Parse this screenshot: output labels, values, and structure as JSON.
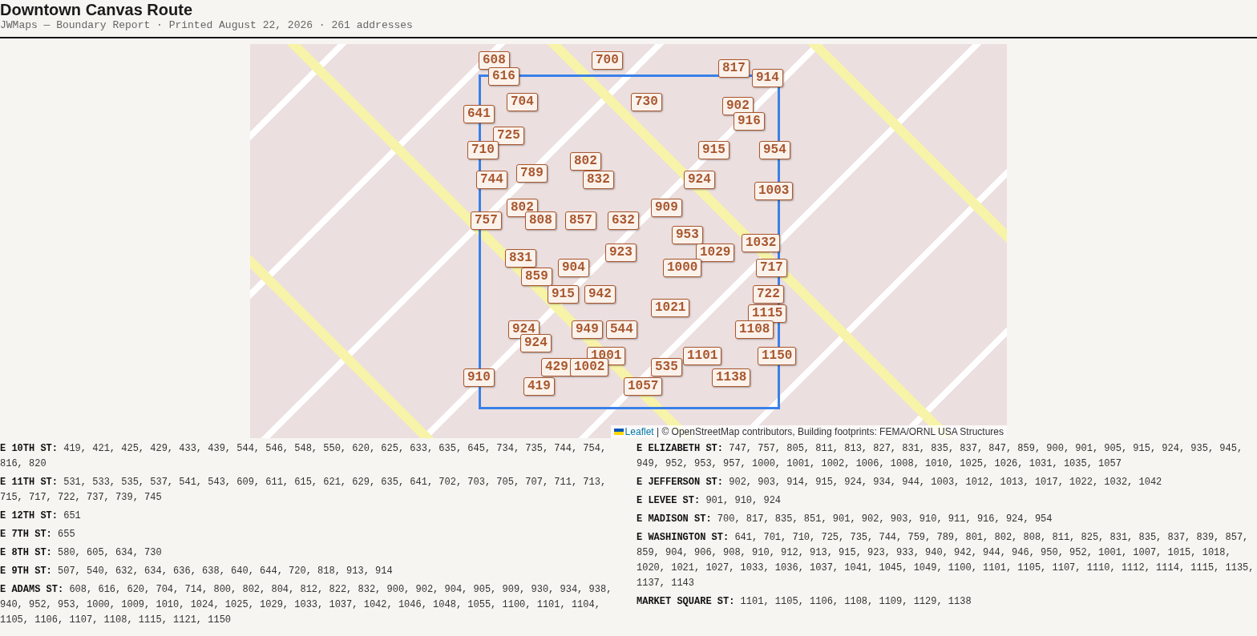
{
  "title": "Downtown Canvas Route",
  "subtitle": "JWMaps — Boundary Report · Printed August 22, 2026 · 261 addresses",
  "map": {
    "markers": [
      "608",
      "700",
      "817",
      "616",
      "914",
      "704",
      "730",
      "902",
      "641",
      "916",
      "725",
      "710",
      "915",
      "954",
      "802",
      "789",
      "744",
      "832",
      "924",
      "1003",
      "802",
      "909",
      "757",
      "808",
      "857",
      "632",
      "953",
      "1032",
      "923",
      "1029",
      "831",
      "904",
      "1000",
      "717",
      "859",
      "915",
      "942",
      "722",
      "1021",
      "1115",
      "924",
      "949",
      "544",
      "1108",
      "924",
      "1001",
      "1101",
      "1150",
      "429",
      "1002",
      "535",
      "910",
      "1138",
      "419",
      "1057"
    ],
    "attribution": {
      "link": "Leaflet",
      "text": "| © OpenStreetMap contributors, Building footprints: FEMA/ORNL USA Structures"
    }
  },
  "columns": [
    {
      "streets": [
        {
          "name": "E 10TH ST:",
          "numbers": "419, 421, 425, 429, 433, 439, 544, 546, 548, 550, 620, 625, 633, 635, 645, 734, 735, 744, 754, 816, 820"
        },
        {
          "name": "E 11TH ST:",
          "numbers": "531, 533, 535, 537, 541, 543, 609, 611, 615, 621, 629, 635, 641, 702, 703, 705, 707, 711, 713, 715, 717, 722, 737, 739, 745"
        },
        {
          "name": "E 12TH ST:",
          "numbers": "651"
        },
        {
          "name": "E 7TH ST:",
          "numbers": "655"
        },
        {
          "name": "E 8TH ST:",
          "numbers": "580, 605, 634, 730"
        },
        {
          "name": "E 9TH ST:",
          "numbers": "507, 540, 632, 634, 636, 638, 640, 644, 720, 818, 913, 914"
        },
        {
          "name": "E ADAMS ST:",
          "numbers": "608, 616, 620, 704, 714, 800, 802, 804, 812, 822, 832, 900, 902, 904, 905, 909, 930, 934, 938, 940, 952, 953, 1000, 1009, 1010, 1024, 1025, 1029, 1033, 1037, 1042, 1046, 1048, 1055, 1100, 1101, 1104, 1105, 1106, 1107, 1108, 1115, 1121, 1150"
        }
      ]
    },
    {
      "streets": [
        {
          "name": "E ELIZABETH ST:",
          "numbers": "747, 757, 805, 811, 813, 827, 831, 835, 837, 847, 859, 900, 901, 905, 915, 924, 935, 945, 949, 952, 953, 957, 1000, 1001, 1002, 1006, 1008, 1010, 1025, 1026, 1031, 1035, 1057"
        },
        {
          "name": "E JEFFERSON ST:",
          "numbers": "902, 903, 914, 915, 924, 934, 944, 1003, 1012, 1013, 1017, 1022, 1032, 1042"
        },
        {
          "name": "E LEVEE ST:",
          "numbers": "901, 910, 924"
        },
        {
          "name": "E MADISON ST:",
          "numbers": "700, 817, 835, 851, 901, 902, 903, 910, 911, 916, 924, 954"
        },
        {
          "name": "E WASHINGTON ST:",
          "numbers": "641, 701, 710, 725, 735, 744, 759, 789, 801, 802, 808, 811, 825, 831, 835, 837, 839, 857, 859, 904, 906, 908, 910, 912, 913, 915, 923, 933, 940, 942, 944, 946, 950, 952, 1001, 1007, 1015, 1018, 1020, 1021, 1027, 1033, 1036, 1037, 1041, 1045, 1049, 1100, 1101, 1105, 1107, 1110, 1112, 1114, 1115, 1135, 1137, 1143"
        },
        {
          "name": "MARKET SQUARE ST:",
          "numbers": "1101, 1105, 1106, 1108, 1109, 1129, 1138"
        }
      ]
    }
  ]
}
